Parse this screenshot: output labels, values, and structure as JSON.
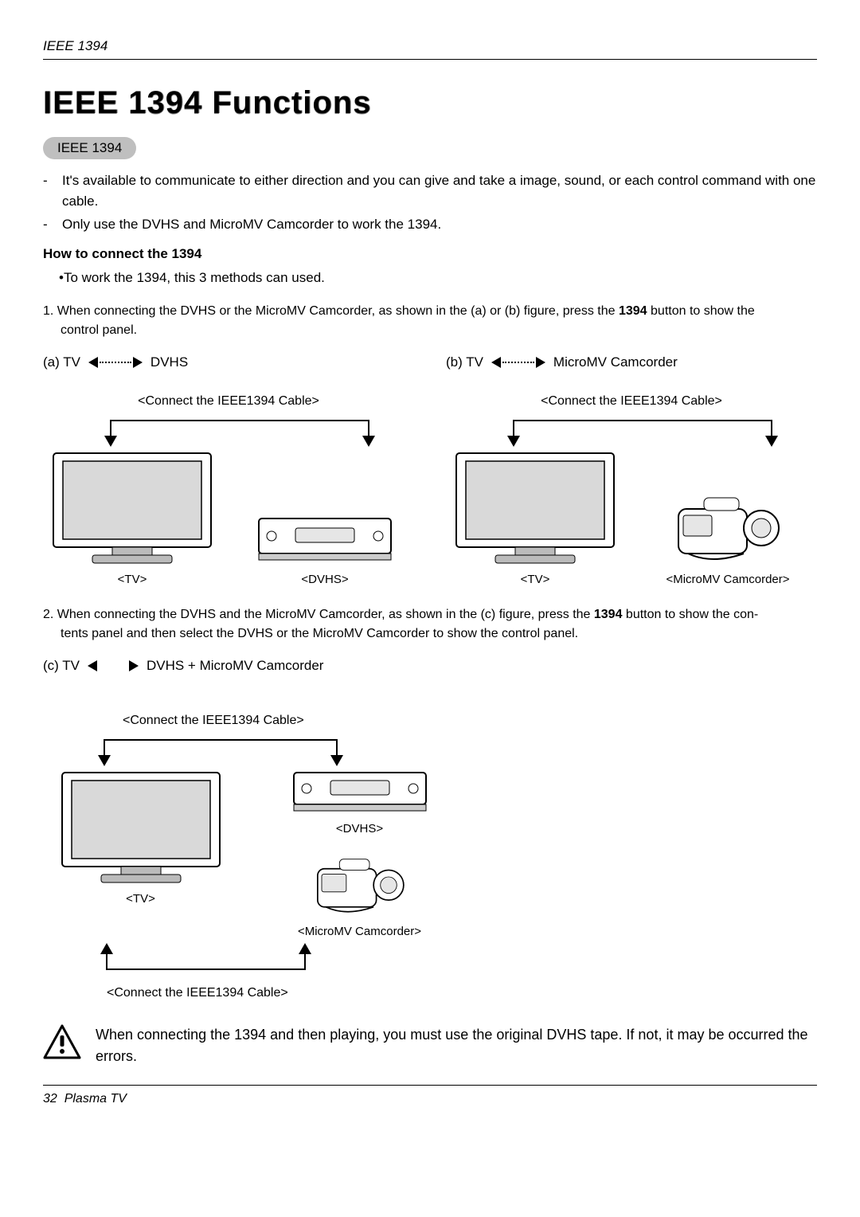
{
  "header_label": "IEEE 1394",
  "title": "IEEE 1394 Functions",
  "pill": "IEEE 1394",
  "intro_bullets": [
    "It's available to communicate to either direction and you can give and take a image, sound, or each control command with one cable.",
    "Only use the DVHS and MicroMV Camcorder to work the 1394."
  ],
  "subhead": "How to connect the 1394",
  "note": "•To work the 1394, this  3 methods can used.",
  "step1_pre": "1. When connecting  the DVHS or the MicroMV Camcorder, as shown in the (a) or (b) figure, press the ",
  "step1_bold": "1394",
  "step1_post": " button to show the",
  "step1_cont": "control panel.",
  "example_a": {
    "prefix": "(a) TV",
    "suffix": "DVHS",
    "cable_caption": "<Connect the IEEE1394 Cable>",
    "tv_label": "<TV>",
    "dvhs_label": "<DVHS>"
  },
  "example_b": {
    "prefix": "(b) TV",
    "suffix": "MicroMV Camcorder",
    "cable_caption": "<Connect the IEEE1394 Cable>",
    "tv_label": "<TV>",
    "cam_label": "<MicroMV Camcorder>"
  },
  "step2_pre": "2. When connecting  the DVHS and the MicroMV Camcorder, as shown in the (c) figure, press the ",
  "step2_bold": "1394",
  "step2_post": " button to show the con-",
  "step2_cont": "tents panel and then select the DVHS or the MicroMV Camcorder to show the control panel.",
  "example_c": {
    "prefix": "(c) TV",
    "suffix": "DVHS + MicroMV Camcorder",
    "cable_caption_top": "<Connect the IEEE1394 Cable>",
    "cable_caption_bottom": "<Connect the IEEE1394 Cable>",
    "tv_label": "<TV>",
    "dvhs_label": "<DVHS>",
    "cam_label": "<MicroMV Camcorder>"
  },
  "warning_text": "When connecting the 1394 and then playing, you must use the original DVHS tape. If not, it may be occurred the errors.",
  "footer_page": "32",
  "footer_text": "Plasma TV"
}
